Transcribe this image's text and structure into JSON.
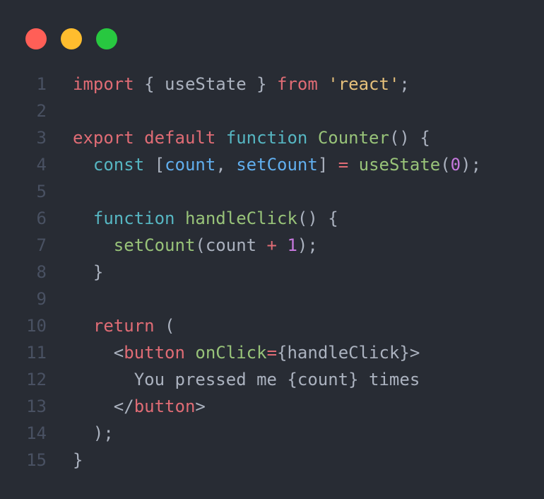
{
  "window": {
    "controls": [
      {
        "name": "close",
        "color": "#ff5f57"
      },
      {
        "name": "minimize",
        "color": "#ffbd2e"
      },
      {
        "name": "maximize",
        "color": "#28c840"
      }
    ]
  },
  "code": {
    "language": "jsx",
    "lines": [
      {
        "number": "1",
        "tokens": [
          {
            "t": "import",
            "c": "keyword"
          },
          {
            "t": " { useState } ",
            "c": "plain"
          },
          {
            "t": "from",
            "c": "keyword"
          },
          {
            "t": " ",
            "c": "plain"
          },
          {
            "t": "'react'",
            "c": "string"
          },
          {
            "t": ";",
            "c": "punct"
          }
        ]
      },
      {
        "number": "2",
        "tokens": []
      },
      {
        "number": "3",
        "tokens": [
          {
            "t": "export",
            "c": "keyword"
          },
          {
            "t": " ",
            "c": "plain"
          },
          {
            "t": "default",
            "c": "keyword"
          },
          {
            "t": " ",
            "c": "plain"
          },
          {
            "t": "function",
            "c": "storage"
          },
          {
            "t": " ",
            "c": "plain"
          },
          {
            "t": "Counter",
            "c": "func"
          },
          {
            "t": "() {",
            "c": "punct"
          }
        ]
      },
      {
        "number": "4",
        "tokens": [
          {
            "t": "  ",
            "c": "plain"
          },
          {
            "t": "const",
            "c": "storage"
          },
          {
            "t": " [",
            "c": "punct"
          },
          {
            "t": "count",
            "c": "var"
          },
          {
            "t": ", ",
            "c": "punct"
          },
          {
            "t": "setCount",
            "c": "var"
          },
          {
            "t": "] ",
            "c": "punct"
          },
          {
            "t": "=",
            "c": "op"
          },
          {
            "t": " ",
            "c": "plain"
          },
          {
            "t": "useState",
            "c": "func"
          },
          {
            "t": "(",
            "c": "punct"
          },
          {
            "t": "0",
            "c": "number"
          },
          {
            "t": ");",
            "c": "punct"
          }
        ]
      },
      {
        "number": "5",
        "tokens": []
      },
      {
        "number": "6",
        "tokens": [
          {
            "t": "  ",
            "c": "plain"
          },
          {
            "t": "function",
            "c": "storage"
          },
          {
            "t": " ",
            "c": "plain"
          },
          {
            "t": "handleClick",
            "c": "func"
          },
          {
            "t": "() {",
            "c": "punct"
          }
        ]
      },
      {
        "number": "7",
        "tokens": [
          {
            "t": "    ",
            "c": "plain"
          },
          {
            "t": "setCount",
            "c": "func"
          },
          {
            "t": "(count ",
            "c": "punct"
          },
          {
            "t": "+",
            "c": "op"
          },
          {
            "t": " ",
            "c": "plain"
          },
          {
            "t": "1",
            "c": "number"
          },
          {
            "t": ");",
            "c": "punct"
          }
        ]
      },
      {
        "number": "8",
        "tokens": [
          {
            "t": "  }",
            "c": "punct"
          }
        ]
      },
      {
        "number": "9",
        "tokens": []
      },
      {
        "number": "10",
        "tokens": [
          {
            "t": "  ",
            "c": "plain"
          },
          {
            "t": "return",
            "c": "keyword"
          },
          {
            "t": " (",
            "c": "punct"
          }
        ]
      },
      {
        "number": "11",
        "tokens": [
          {
            "t": "    <",
            "c": "punct"
          },
          {
            "t": "button",
            "c": "tag"
          },
          {
            "t": " ",
            "c": "plain"
          },
          {
            "t": "onClick",
            "c": "attr"
          },
          {
            "t": "=",
            "c": "op"
          },
          {
            "t": "{handleClick}>",
            "c": "punct"
          }
        ]
      },
      {
        "number": "12",
        "tokens": [
          {
            "t": "      You pressed me {count} times",
            "c": "plain"
          }
        ]
      },
      {
        "number": "13",
        "tokens": [
          {
            "t": "    </",
            "c": "punct"
          },
          {
            "t": "button",
            "c": "tag"
          },
          {
            "t": ">",
            "c": "punct"
          }
        ]
      },
      {
        "number": "14",
        "tokens": [
          {
            "t": "  );",
            "c": "punct"
          }
        ]
      },
      {
        "number": "15",
        "tokens": [
          {
            "t": "}",
            "c": "punct"
          }
        ]
      }
    ]
  }
}
